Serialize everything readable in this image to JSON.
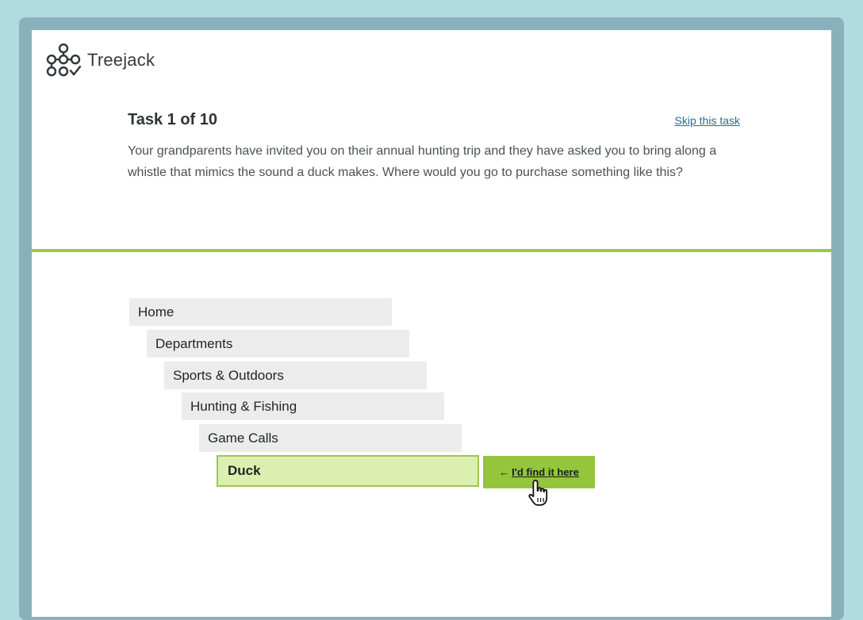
{
  "app": {
    "name": "Treejack",
    "logo_icon": "treejack-logo-icon"
  },
  "task": {
    "title": "Task 1 of 10",
    "skip_label": "Skip this task",
    "description": "Your grandparents have invited you on their annual hunting trip and they have asked you to bring along a whistle that mimics the sound a duck makes. Where would you go to purchase something like this?"
  },
  "tree": {
    "items": [
      {
        "label": "Home",
        "level": 0,
        "selected": false
      },
      {
        "label": "Departments",
        "level": 1,
        "selected": false
      },
      {
        "label": "Sports & Outdoors",
        "level": 2,
        "selected": false
      },
      {
        "label": "Hunting & Fishing",
        "level": 3,
        "selected": false
      },
      {
        "label": "Game Calls",
        "level": 4,
        "selected": false
      },
      {
        "label": "Duck",
        "level": 5,
        "selected": true
      }
    ],
    "find_button": {
      "arrow": "←",
      "label": "I'd find it here"
    }
  },
  "colors": {
    "background": "#b0dbe1",
    "frame": "#8ab1bb",
    "accent_green": "#9cc84b",
    "button_green": "#94c53c",
    "selected_fill": "#dcefb0",
    "item_fill": "#ececec",
    "link": "#2d6c88"
  },
  "icons": {
    "cursor": "hand-pointer-icon"
  }
}
